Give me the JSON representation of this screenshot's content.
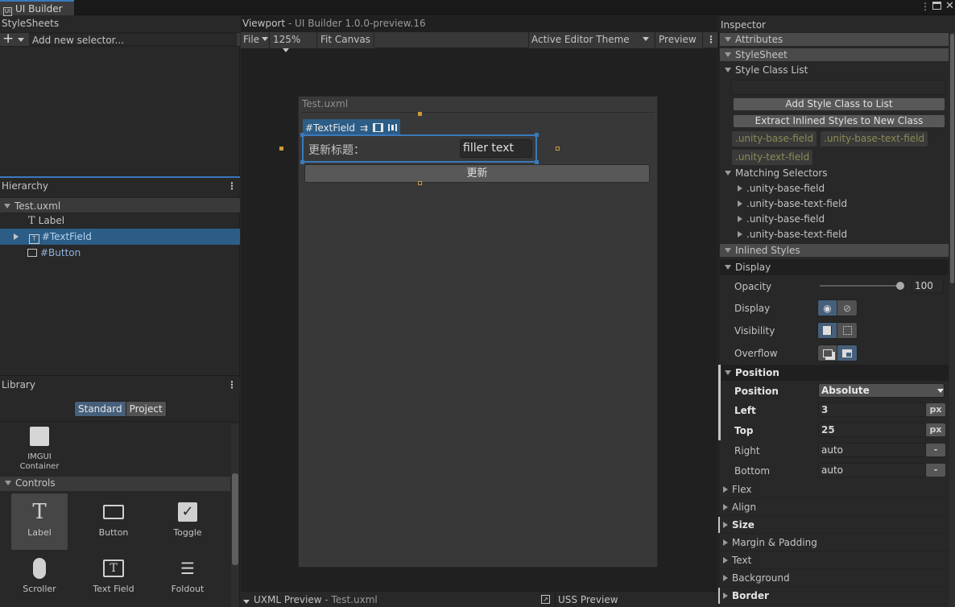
{
  "window": {
    "tab_title": "UI Builder",
    "menu_icon": "kebab-icon",
    "maximize_icon": "maximize-icon",
    "close_icon": "close-icon"
  },
  "stylesheets": {
    "title": "StyleSheets",
    "add_label": "+",
    "selector_placeholder": "Add new selector..."
  },
  "hierarchy": {
    "title": "Hierarchy",
    "rows": [
      {
        "label": "Test.uxml"
      },
      {
        "label": "Label"
      },
      {
        "label": "#TextField"
      },
      {
        "label": "#Button"
      }
    ]
  },
  "library": {
    "title": "Library",
    "tabs": [
      {
        "label": "Standard"
      },
      {
        "label": "Project"
      }
    ],
    "imgui": {
      "label_line1": "IMGUI",
      "label_line2": "Container"
    },
    "controls_header": "Controls",
    "items": [
      {
        "label": "Label",
        "icon": "label-icon"
      },
      {
        "label": "Button",
        "icon": "button-icon"
      },
      {
        "label": "Toggle",
        "icon": "toggle-icon"
      },
      {
        "label": "Scroller",
        "icon": "scroller-icon"
      },
      {
        "label": "Text Field",
        "icon": "text-field-icon"
      },
      {
        "label": "Foldout",
        "icon": "foldout-icon"
      }
    ]
  },
  "viewport": {
    "title": "Viewport",
    "subtitle": "- UI Builder 1.0.0-preview.16",
    "toolbar": {
      "file": "File",
      "zoom": "125%",
      "fit": "Fit Canvas",
      "theme": "Active Editor Theme",
      "preview": "Preview"
    },
    "canvas": {
      "doc_title": "Test.uxml",
      "selected_tag": "#TextField",
      "field_label": "更新标题：",
      "field_value": "filler text",
      "button_label": "更新"
    }
  },
  "uxml_preview": {
    "title": "UXML Preview",
    "subtitle": "- Test.uxml"
  },
  "uss_preview": {
    "title": "USS Preview"
  },
  "inspector": {
    "title": "Inspector",
    "attributes": "Attributes",
    "stylesheet": "StyleSheet",
    "style_class_list": "Style Class List",
    "add_class_button": "Add Style Class to List",
    "extract_button": "Extract Inlined Styles to New Class",
    "classes": [
      ".unity-base-field",
      ".unity-base-text-field",
      ".unity-text-field"
    ],
    "matching_selectors_title": "Matching Selectors",
    "matching_selectors": [
      ".unity-base-field",
      ".unity-base-text-field",
      ".unity-base-field",
      ".unity-base-text-field"
    ],
    "inlined_styles": "Inlined Styles",
    "display_section": "Display",
    "opacity_label": "Opacity",
    "opacity_value": "100",
    "opacity_level": 1.0,
    "display_label": "Display",
    "visibility_label": "Visibility",
    "overflow_label": "Overflow",
    "position_section": "Position",
    "position_label": "Position",
    "position_value": "Absolute",
    "left_label": "Left",
    "left_value": "3",
    "top_label": "Top",
    "top_value": "25",
    "right_label": "Right",
    "right_value": "auto",
    "bottom_label": "Bottom",
    "bottom_value": "auto",
    "unit_px": "px",
    "unit_none": "-",
    "collapsed_sections": [
      "Flex",
      "Align",
      "Size",
      "Margin & Padding",
      "Text",
      "Background",
      "Border"
    ]
  },
  "colors": {
    "selection": "#2c5d87",
    "accent": "#3a79bb",
    "class_pill_text": "#8c8a55"
  }
}
